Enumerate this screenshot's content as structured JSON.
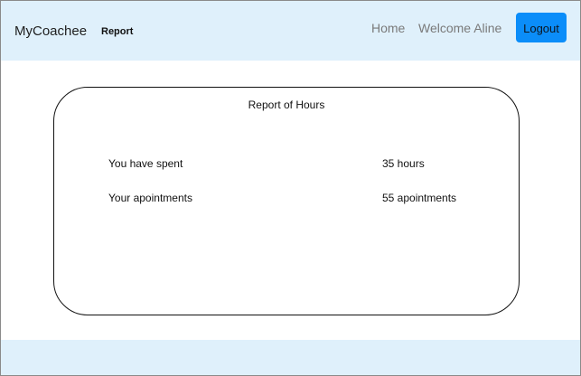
{
  "app": {
    "brand": "MyCoachee"
  },
  "nav": {
    "report": "Report",
    "home": "Home",
    "welcome": "Welcome Aline",
    "logout": "Logout"
  },
  "report": {
    "title": "Report of Hours",
    "rows": [
      {
        "label": "You have spent",
        "value": "35 hours"
      },
      {
        "label": "Your apointments",
        "value": "55 apointments"
      }
    ]
  },
  "colors": {
    "header_background": "#dff0fb",
    "logout_button": "#0b8df9",
    "nav_link_muted": "#7a7a7a",
    "card_border": "#111111"
  }
}
